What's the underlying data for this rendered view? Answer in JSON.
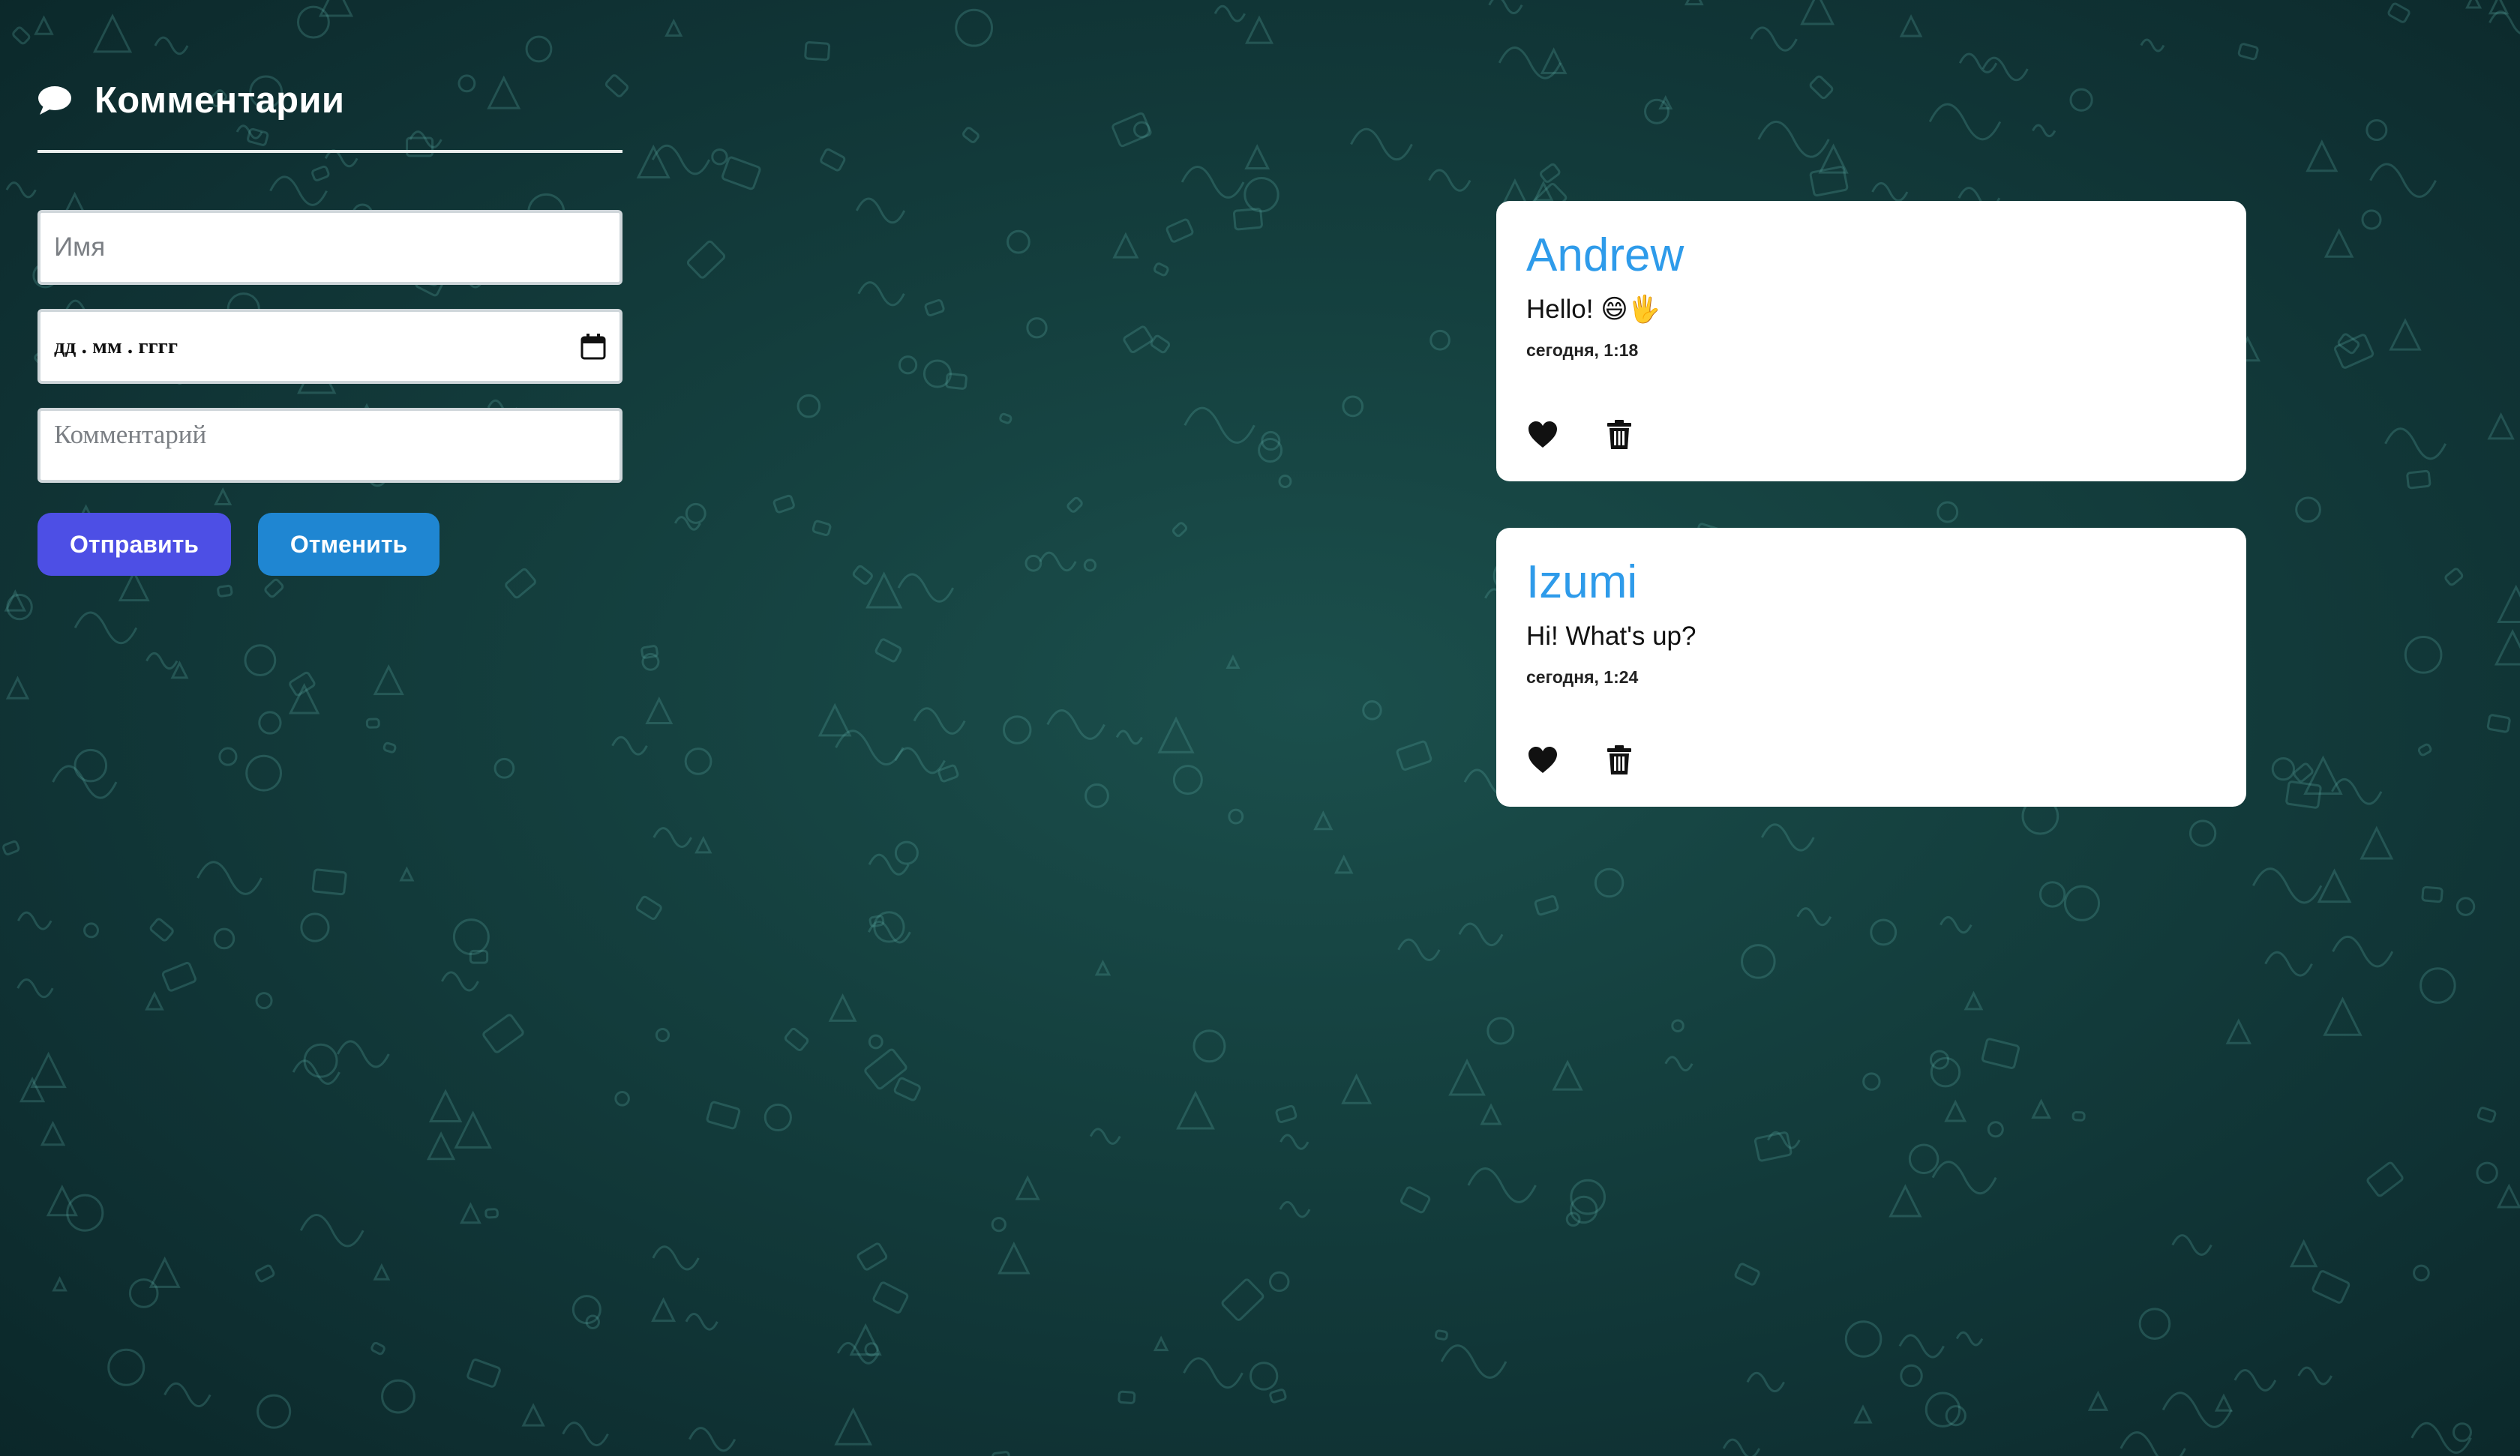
{
  "form": {
    "title": "Комментарии",
    "title_icon": "chat-bubble-icon",
    "name_placeholder": "Имя",
    "date_placeholder": "дд . мм . гггг",
    "date_icon": "calendar-icon",
    "comment_placeholder": "Комментарий",
    "send_label": "Отправить",
    "cancel_label": "Отменить"
  },
  "comments": [
    {
      "author": "Andrew",
      "text": "Hello! 😄🖐",
      "time": "сегодня, 1:18",
      "like_icon": "heart-icon",
      "delete_icon": "trash-icon"
    },
    {
      "author": "Izumi",
      "text": "Hi! What's up?",
      "time": "сегодня, 1:24",
      "like_icon": "heart-icon",
      "delete_icon": "trash-icon"
    }
  ],
  "colors": {
    "background": "#143f3e",
    "send_button": "#4d4fe5",
    "cancel_button": "#1f86d2",
    "author_name": "#2e9bea"
  }
}
